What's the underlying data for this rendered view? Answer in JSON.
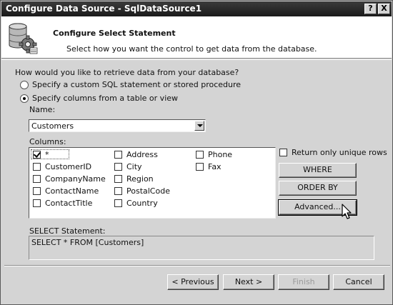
{
  "window": {
    "title": "Configure Data Source - SqlDataSource1",
    "help_button": "?",
    "close_button": "X"
  },
  "header": {
    "title": "Configure Select Statement",
    "subtitle": "Select how you want the control to get data from the database."
  },
  "retrieve": {
    "question": "How would you like to retrieve data from your database?",
    "option_custom": "Specify a custom SQL statement or stored procedure",
    "option_columns": "Specify columns from a table or view",
    "selected": "option_columns"
  },
  "name": {
    "label": "Name:",
    "value": "Customers"
  },
  "columns": {
    "label": "Columns:",
    "items": [
      {
        "label": "*",
        "checked": true
      },
      {
        "label": "CustomerID",
        "checked": false
      },
      {
        "label": "CompanyName",
        "checked": false
      },
      {
        "label": "ContactName",
        "checked": false
      },
      {
        "label": "ContactTitle",
        "checked": false
      },
      {
        "label": "Address",
        "checked": false
      },
      {
        "label": "City",
        "checked": false
      },
      {
        "label": "Region",
        "checked": false
      },
      {
        "label": "PostalCode",
        "checked": false
      },
      {
        "label": "Country",
        "checked": false
      },
      {
        "label": "Phone",
        "checked": false
      },
      {
        "label": "Fax",
        "checked": false
      }
    ]
  },
  "options": {
    "unique_rows_label": "Return only unique rows",
    "unique_rows_checked": false,
    "where_label": "WHERE",
    "order_by_label": "ORDER BY",
    "advanced_label": "Advanced..."
  },
  "sql": {
    "label": "SELECT Statement:",
    "value": "SELECT * FROM [Customers]"
  },
  "footer": {
    "previous_label": "< Previous",
    "next_label": "Next >",
    "finish_label": "Finish",
    "cancel_label": "Cancel"
  },
  "icons": {
    "header": "database-gear-icon",
    "cursor": "mouse-pointer-icon"
  }
}
